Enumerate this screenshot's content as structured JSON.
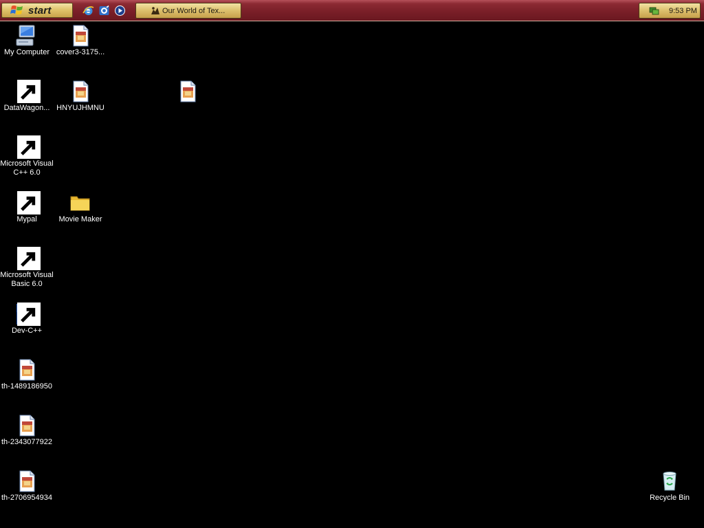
{
  "taskbar": {
    "start_label": "start",
    "active_task_label": "Our World of Tex...",
    "clock": "9:53 PM",
    "colors": {
      "bar": "#7a1f28",
      "button": "#e0c46c"
    }
  },
  "quick_launch": [
    {
      "name": "internet-explorer-icon"
    },
    {
      "name": "outlook-express-icon"
    },
    {
      "name": "media-player-icon"
    }
  ],
  "desktop": {
    "background": "#000000",
    "icons": {
      "my_computer": "My Computer",
      "cover3": "cover3-3175...",
      "datawagon": "DataWagon...",
      "hnyujhmnu": "HNYUJHMNU",
      "msvc_line1": "Microsoft Visual",
      "msvc_line2": "C++ 6.0",
      "mypal": "Mypal",
      "movie_maker": "Movie Maker",
      "msvb_line1": "Microsoft Visual",
      "msvb_line2": "Basic 6.0",
      "devcpp": "Dev-C++",
      "th1": "th-1489186950",
      "th2": "th-2343077922",
      "th3": "th-2706954934",
      "recycle_bin": "Recycle Bin"
    }
  }
}
